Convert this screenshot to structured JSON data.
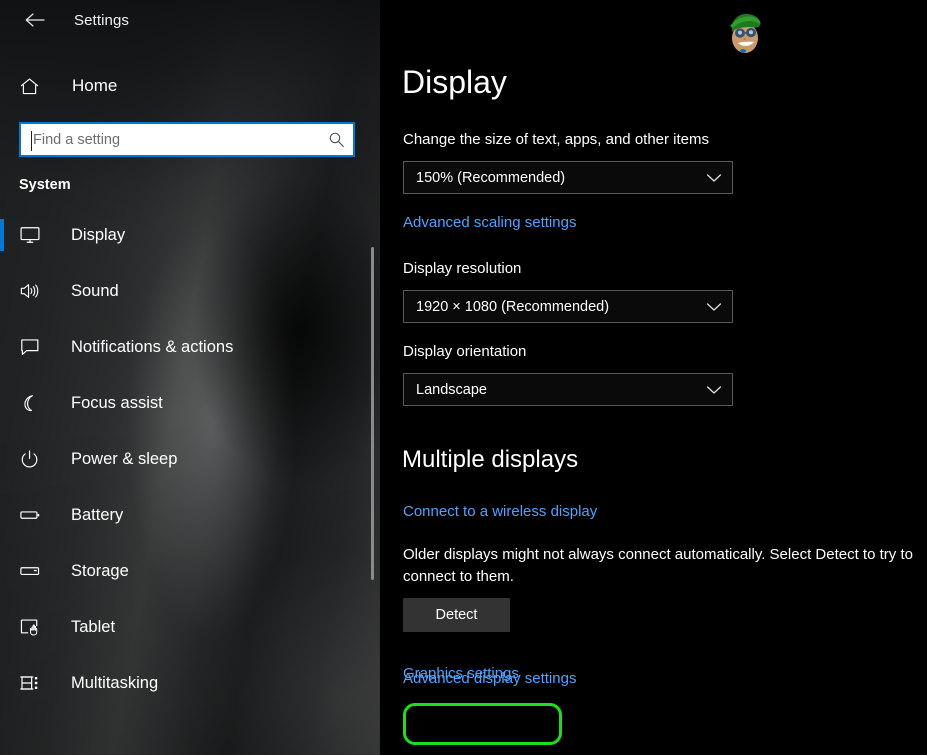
{
  "window": {
    "title": "Settings",
    "back_icon": "back-arrow-icon"
  },
  "sidebar": {
    "home": {
      "label": "Home",
      "icon": "home-icon"
    },
    "search": {
      "placeholder": "Find a setting",
      "value": "",
      "icon": "search-icon"
    },
    "heading": "System",
    "items": [
      {
        "label": "Display",
        "icon": "monitor-icon",
        "selected": true
      },
      {
        "label": "Sound",
        "icon": "speaker-icon",
        "selected": false
      },
      {
        "label": "Notifications & actions",
        "icon": "chat-bubble-icon",
        "selected": false
      },
      {
        "label": "Focus assist",
        "icon": "moon-icon",
        "selected": false
      },
      {
        "label": "Power & sleep",
        "icon": "power-icon",
        "selected": false
      },
      {
        "label": "Battery",
        "icon": "battery-icon",
        "selected": false
      },
      {
        "label": "Storage",
        "icon": "drive-icon",
        "selected": false
      },
      {
        "label": "Tablet",
        "icon": "tablet-touch-icon",
        "selected": false
      },
      {
        "label": "Multitasking",
        "icon": "multitasking-icon",
        "selected": false
      }
    ]
  },
  "main": {
    "title": "Display",
    "scale": {
      "label": "Change the size of text, apps, and other items",
      "value": "150% (Recommended)",
      "link": "Advanced scaling settings"
    },
    "resolution": {
      "label": "Display resolution",
      "value": "1920 × 1080 (Recommended)"
    },
    "orientation": {
      "label": "Display orientation",
      "value": "Landscape"
    },
    "multiple_displays": {
      "heading": "Multiple displays",
      "wireless_link": "Connect to a wireless display",
      "description": "Older displays might not always connect automatically. Select Detect to try to connect to them.",
      "detect_button": "Detect"
    },
    "advanced_display_link": "Advanced display settings",
    "graphics_settings_link": "Graphics settings"
  },
  "colors": {
    "accent_blue": "#0078d7",
    "link_blue": "#4da3ff",
    "highlight_green": "#19e019",
    "button_gray": "#333333",
    "background": "#000000"
  }
}
